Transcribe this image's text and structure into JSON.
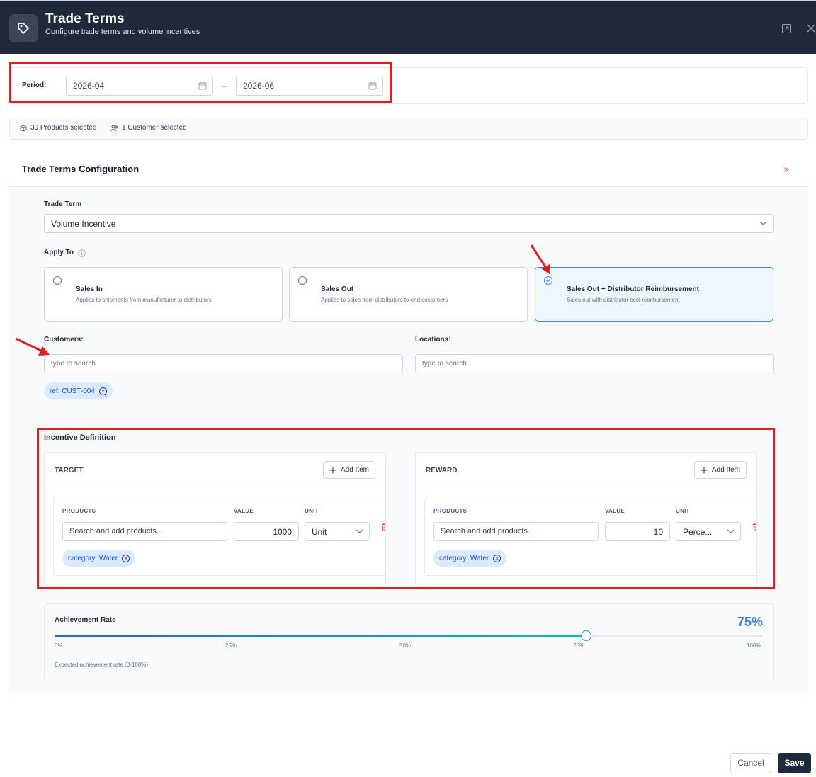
{
  "header": {
    "title": "Trade Terms",
    "subtitle": "Configure trade terms and volume incentives",
    "logo_icon": "tag-icon",
    "expand_icon": "expand-icon",
    "close_icon": "close-icon"
  },
  "period": {
    "label": "Period:",
    "start": "2026-04",
    "end": "2026-06",
    "separator": "–"
  },
  "selection": {
    "products": "30 Products selected",
    "customers": "1 Customer selected"
  },
  "config": {
    "title": "Trade Terms Configuration",
    "close": "×",
    "trade_term_label": "Trade Term",
    "trade_term_value": "Volume Incentive",
    "apply_to_label": "Apply To",
    "apply_options": [
      {
        "title": "Sales In",
        "desc": "Applies to shipments from manufacturer to distributors",
        "selected": false
      },
      {
        "title": "Sales Out",
        "desc": "Applies to sales from distributors to end customers",
        "selected": false
      },
      {
        "title": "Sales Out + Distributor Reimbursement",
        "desc": "Sales out with distributor cost reimbursement",
        "selected": true
      }
    ],
    "customers_label": "Customers:",
    "customers_placeholder": "type to search",
    "customer_chip": "ref: CUST-004",
    "locations_label": "Locations:",
    "locations_placeholder": "type to search"
  },
  "incentive": {
    "title": "Incentive Definition",
    "add_item": "Add Item",
    "col_products": "PRODUCTS",
    "col_value": "VALUE",
    "col_unit": "UNIT",
    "products_placeholder": "Search and add products...",
    "target": {
      "title": "TARGET",
      "value": "1000",
      "unit": "Unit",
      "chip": "category: Water"
    },
    "reward": {
      "title": "REWARD",
      "value": "10",
      "unit": "Perce...",
      "chip": "category: Water"
    }
  },
  "achievement": {
    "label": "Achievement Rate",
    "value_text": "75%",
    "value": 0.75,
    "ticks": [
      "0%",
      "25%",
      "50%",
      "75%",
      "100%"
    ],
    "help": "Expected achievement rate (0-100%)"
  },
  "footer": {
    "cancel": "Cancel",
    "save": "Save"
  },
  "colors": {
    "header_bg": "#1e293b",
    "accent": "#3b82f6",
    "highlight_red": "#e31d1d",
    "chip_bg": "#dbeafe"
  }
}
